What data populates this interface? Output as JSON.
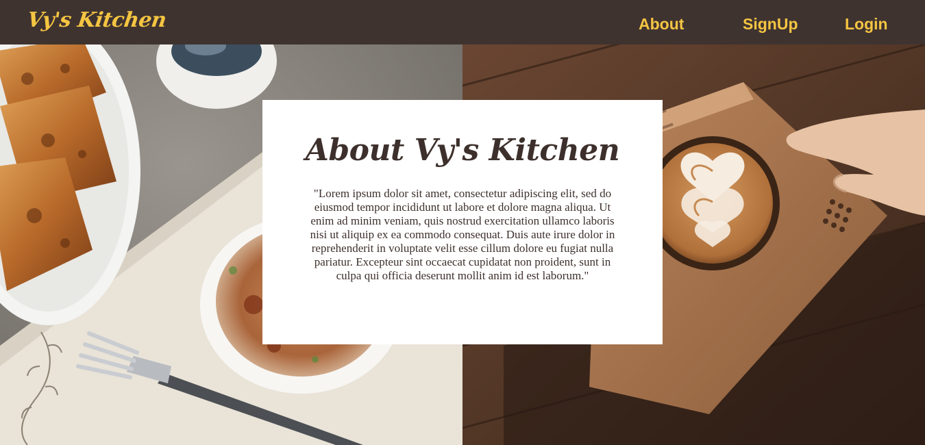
{
  "header": {
    "logo": "Vy's Kitchen",
    "nav": [
      {
        "label": "About"
      },
      {
        "label": "SignUp"
      },
      {
        "label": "Login"
      }
    ]
  },
  "about_card": {
    "title": "About Vy's Kitchen",
    "body": "\"Lorem ipsum dolor sit amet, consectetur adipiscing elit, sed do eiusmod tempor incididunt ut labore et dolore magna aliqua. Ut enim ad minim veniam, quis nostrud exercitation ullamco laboris nisi ut aliquip ex ea commodo consequat. Duis aute irure dolor in reprehenderit in voluptate velit esse cillum dolore eu fugiat nulla pariatur. Excepteur sint occaecat cupidatat non proident, sunt in culpa qui officia deserunt mollit anim id est laborum.\""
  },
  "colors": {
    "header_bg": "#3f3330",
    "accent": "#f5c542",
    "text_dark": "#3d302c",
    "card_bg": "#ffffff"
  }
}
